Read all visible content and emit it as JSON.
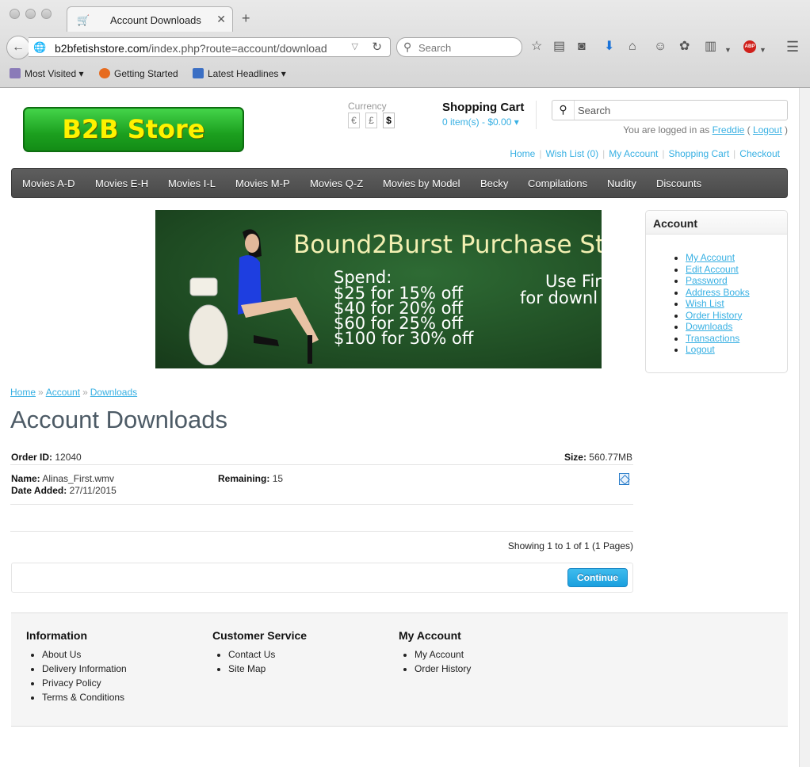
{
  "browser": {
    "tab_title": "Account Downloads",
    "url_host": "b2bfetishstore.com",
    "url_path": "/index.php?route=account/download",
    "search_placeholder": "Search",
    "bookmarks": [
      "Most Visited",
      "Getting Started",
      "Latest Headlines"
    ],
    "abp_label": "ABP"
  },
  "header": {
    "logo_text": "B2B Store",
    "currency_label": "Currency",
    "currency_options": [
      "€",
      "£",
      "$"
    ],
    "cart_title": "Shopping Cart",
    "cart_total": "0 item(s) - $0.00",
    "search_placeholder": "Search",
    "login_prefix": "You are logged in as",
    "login_user": "Freddie",
    "logout_label": "Logout",
    "top_links": [
      "Home",
      "Wish List (0)",
      "My Account",
      "Shopping Cart",
      "Checkout"
    ]
  },
  "menu": [
    "Movies A-D",
    "Movies E-H",
    "Movies I-L",
    "Movies M-P",
    "Movies Q-Z",
    "Movies by Model",
    "Becky",
    "Compilations",
    "Nudity",
    "Discounts"
  ],
  "banner": {
    "title": "Bound2Burst Purchase St",
    "spend_lines": [
      "Spend:",
      "$25 for 15% off",
      "$40 for 20% off",
      "$60 for 25% off",
      "$100 for 30% off"
    ],
    "right_lines": [
      "Use Fir",
      "for downl"
    ]
  },
  "breadcrumb": [
    "Home",
    "Account",
    "Downloads"
  ],
  "page_title": "Account Downloads",
  "order": {
    "order_id_label": "Order ID:",
    "order_id": "12040",
    "size_label": "Size:",
    "size": "560.77MB",
    "name_label": "Name:",
    "name": "Alinas_First.wmv",
    "date_label": "Date Added:",
    "date": "27/11/2015",
    "remaining_label": "Remaining:",
    "remaining": "15"
  },
  "pagination_text": "Showing 1 to 1 of 1 (1 Pages)",
  "continue_label": "Continue",
  "account_box": {
    "title": "Account",
    "links": [
      "My Account",
      "Edit Account",
      "Password",
      "Address Books",
      "Wish List",
      "Order History",
      "Downloads",
      "Transactions",
      "Logout"
    ]
  },
  "footer": {
    "information": {
      "title": "Information",
      "links": [
        "About Us",
        "Delivery Information",
        "Privacy Policy",
        "Terms & Conditions"
      ]
    },
    "customer_service": {
      "title": "Customer Service",
      "links": [
        "Contact Us",
        "Site Map"
      ]
    },
    "my_account": {
      "title": "My Account",
      "links": [
        "My Account",
        "Order History"
      ]
    }
  },
  "colors": {
    "accent": "#38b0e3",
    "logo_bg": "#1ca01f",
    "logo_text": "#fff200",
    "menu_bg": "#4a4a4a"
  }
}
